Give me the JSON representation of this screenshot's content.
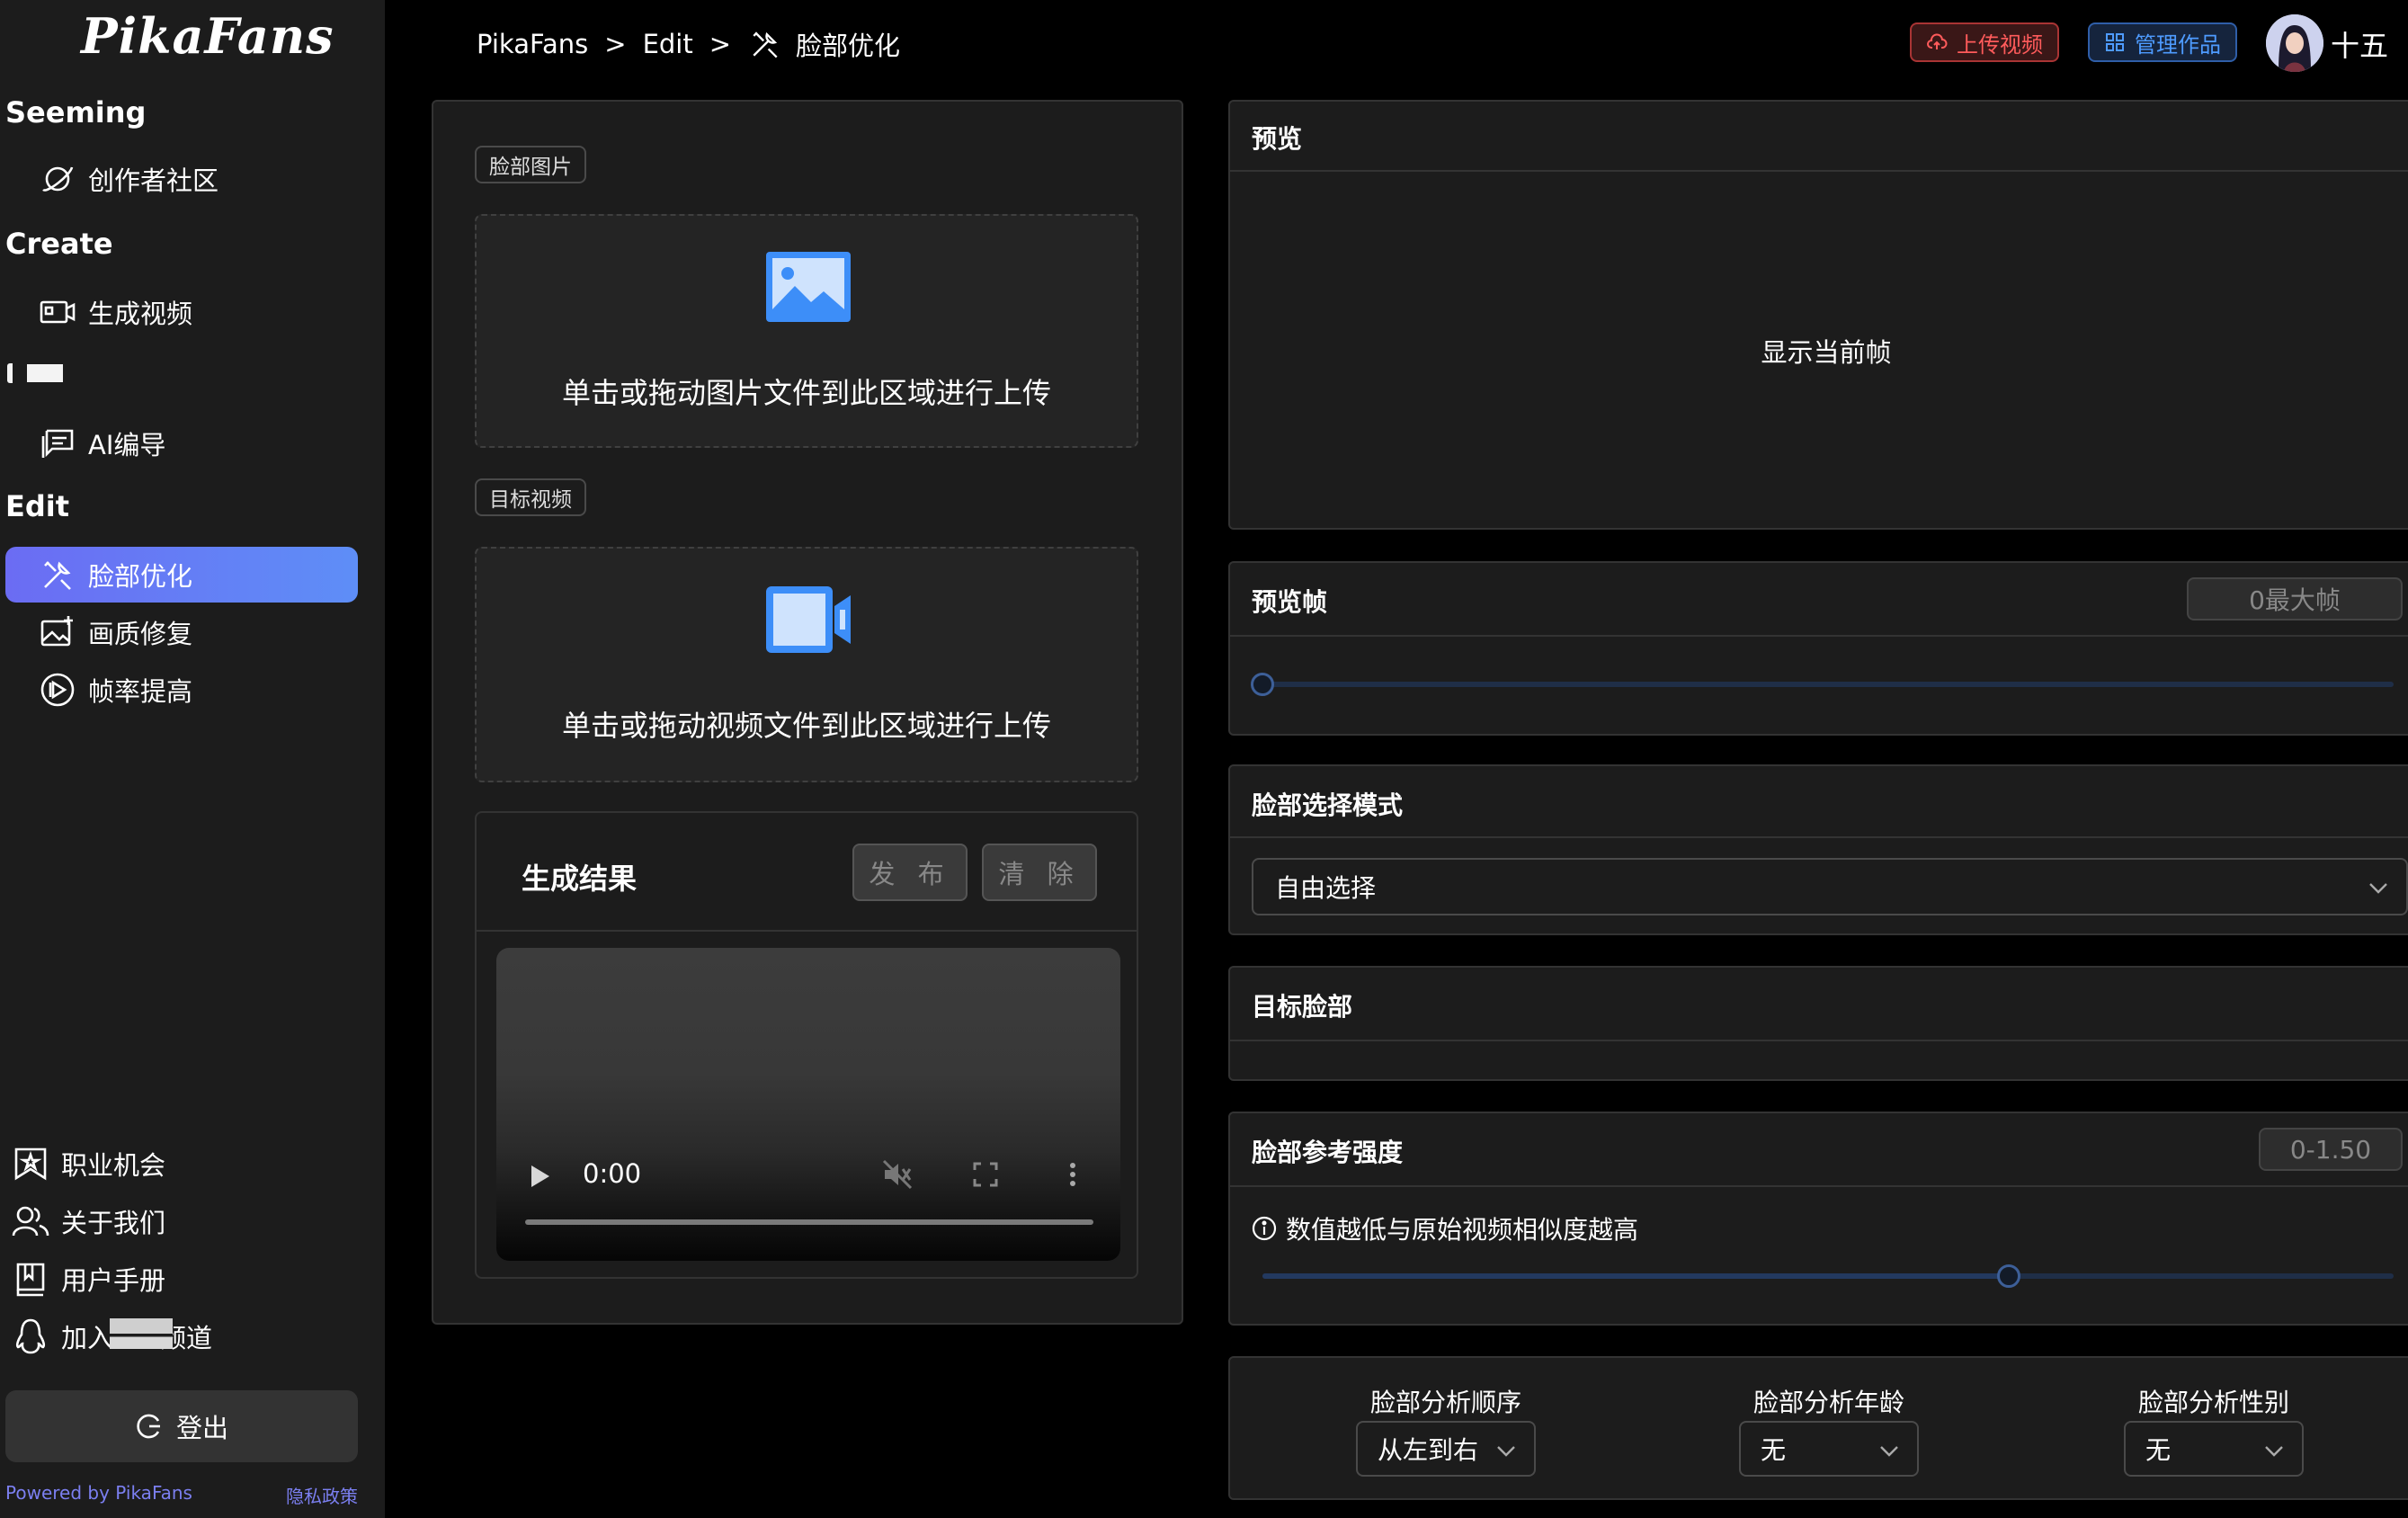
{
  "brand": {
    "logo": "PikaFans"
  },
  "sidebar": {
    "sections": [
      {
        "title": "Seeming"
      },
      {
        "title": "Create"
      },
      {
        "title": "Edit"
      }
    ],
    "items": [
      {
        "label": "创作者社区",
        "icon": "planet-icon"
      },
      {
        "label": "生成视频",
        "icon": "video-camera-icon"
      },
      {
        "label": "AI编导",
        "icon": "chat-script-icon"
      },
      {
        "label": "脸部优化",
        "icon": "tools-icon",
        "active": true
      },
      {
        "label": "画质修复",
        "icon": "image-plus-icon"
      },
      {
        "label": "帧率提高",
        "icon": "play-circle-icon"
      }
    ],
    "bottom_items": [
      {
        "label": "职业机会",
        "icon": "bookmark-star-icon"
      },
      {
        "label": "关于我们",
        "icon": "users-icon"
      },
      {
        "label": "用户手册",
        "icon": "book-icon"
      },
      {
        "label_prefix": "加入",
        "label_suffix": "频道",
        "icon": "qq-penguin-icon"
      }
    ],
    "logout_label": "登出",
    "powered_by": "Powered by PikaFans",
    "privacy": "隐私政策"
  },
  "header": {
    "breadcrumb": [
      "PikaFans",
      "Edit",
      "脸部优化"
    ],
    "breadcrumb_separator": ">",
    "upload_video": "上传视频",
    "manage_works": "管理作品",
    "username": "十五"
  },
  "editor": {
    "face_image_tag": "脸部图片",
    "face_image_drop": "单击或拖动图片文件到此区域进行上传",
    "target_video_tag": "目标视频",
    "target_video_drop": "单击或拖动视频文件到此区域进行上传",
    "result_title": "生成结果",
    "publish_button": "发 布",
    "clear_button": "清 除",
    "video_time": "0:00"
  },
  "settings": {
    "preview": {
      "title": "预览",
      "placeholder": "显示当前帧"
    },
    "preview_frame": {
      "title": "预览帧",
      "badge": "0最大帧",
      "value_fraction": 0
    },
    "face_select_mode": {
      "title": "脸部选择模式",
      "value": "自由选择"
    },
    "target_face": {
      "title": "目标脸部"
    },
    "face_ref_strength": {
      "title": "脸部参考强度",
      "badge": "0-1.50",
      "hint": "数值越低与原始视频相似度越高",
      "value_fraction": 0.66
    },
    "analysis": [
      {
        "label": "脸部分析顺序",
        "value": "从左到右"
      },
      {
        "label": "脸部分析年龄",
        "value": "无"
      },
      {
        "label": "脸部分析性别",
        "value": "无"
      }
    ]
  },
  "colors": {
    "accent_gradient_start": "#6b6cf3",
    "accent_gradient_end": "#5e8ef7",
    "upload_red": "#ff5b5b",
    "manage_blue": "#4e9bff",
    "icon_blue": "#3d8ef8"
  }
}
